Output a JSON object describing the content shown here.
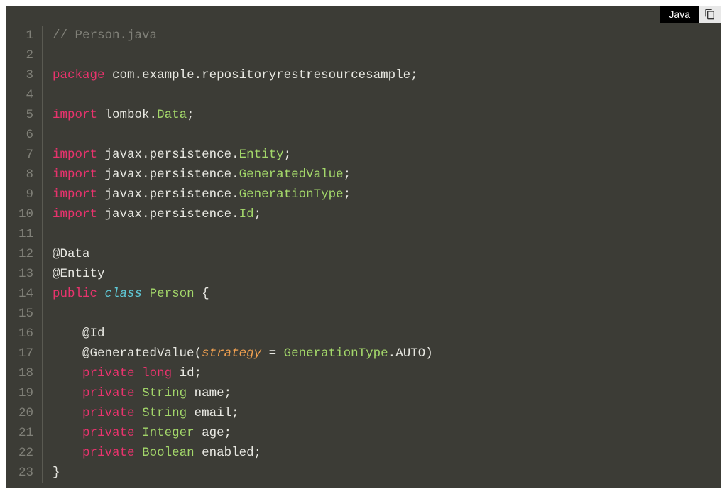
{
  "language_badge": "Java",
  "line_count": 23,
  "code": {
    "lines": [
      [
        {
          "t": "comment",
          "v": "// Person.java"
        }
      ],
      [],
      [
        {
          "t": "keyword",
          "v": "package"
        },
        {
          "t": "plain",
          "v": " com"
        },
        {
          "t": "punct",
          "v": "."
        },
        {
          "t": "plain",
          "v": "example"
        },
        {
          "t": "punct",
          "v": "."
        },
        {
          "t": "plain",
          "v": "repositoryrestresourcesample"
        },
        {
          "t": "punct",
          "v": ";"
        }
      ],
      [],
      [
        {
          "t": "keyword",
          "v": "import"
        },
        {
          "t": "plain",
          "v": " lombok"
        },
        {
          "t": "punct",
          "v": "."
        },
        {
          "t": "type",
          "v": "Data"
        },
        {
          "t": "punct",
          "v": ";"
        }
      ],
      [],
      [
        {
          "t": "keyword",
          "v": "import"
        },
        {
          "t": "plain",
          "v": " javax"
        },
        {
          "t": "punct",
          "v": "."
        },
        {
          "t": "plain",
          "v": "persistence"
        },
        {
          "t": "punct",
          "v": "."
        },
        {
          "t": "type",
          "v": "Entity"
        },
        {
          "t": "punct",
          "v": ";"
        }
      ],
      [
        {
          "t": "keyword",
          "v": "import"
        },
        {
          "t": "plain",
          "v": " javax"
        },
        {
          "t": "punct",
          "v": "."
        },
        {
          "t": "plain",
          "v": "persistence"
        },
        {
          "t": "punct",
          "v": "."
        },
        {
          "t": "type",
          "v": "GeneratedValue"
        },
        {
          "t": "punct",
          "v": ";"
        }
      ],
      [
        {
          "t": "keyword",
          "v": "import"
        },
        {
          "t": "plain",
          "v": " javax"
        },
        {
          "t": "punct",
          "v": "."
        },
        {
          "t": "plain",
          "v": "persistence"
        },
        {
          "t": "punct",
          "v": "."
        },
        {
          "t": "type",
          "v": "GenerationType"
        },
        {
          "t": "punct",
          "v": ";"
        }
      ],
      [
        {
          "t": "keyword",
          "v": "import"
        },
        {
          "t": "plain",
          "v": " javax"
        },
        {
          "t": "punct",
          "v": "."
        },
        {
          "t": "plain",
          "v": "persistence"
        },
        {
          "t": "punct",
          "v": "."
        },
        {
          "t": "type",
          "v": "Id"
        },
        {
          "t": "punct",
          "v": ";"
        }
      ],
      [],
      [
        {
          "t": "plain",
          "v": "@Data"
        }
      ],
      [
        {
          "t": "plain",
          "v": "@Entity"
        }
      ],
      [
        {
          "t": "keyword",
          "v": "public"
        },
        {
          "t": "plain",
          "v": " "
        },
        {
          "t": "class-kw",
          "v": "class"
        },
        {
          "t": "plain",
          "v": " "
        },
        {
          "t": "type",
          "v": "Person"
        },
        {
          "t": "plain",
          "v": " "
        },
        {
          "t": "punct",
          "v": "{"
        }
      ],
      [],
      [
        {
          "t": "plain",
          "v": "    @Id"
        }
      ],
      [
        {
          "t": "plain",
          "v": "    @GeneratedValue"
        },
        {
          "t": "punct",
          "v": "("
        },
        {
          "t": "param",
          "v": "strategy"
        },
        {
          "t": "plain",
          "v": " "
        },
        {
          "t": "punct",
          "v": "="
        },
        {
          "t": "plain",
          "v": " "
        },
        {
          "t": "type",
          "v": "GenerationType"
        },
        {
          "t": "punct",
          "v": "."
        },
        {
          "t": "plain",
          "v": "AUTO"
        },
        {
          "t": "punct",
          "v": ")"
        }
      ],
      [
        {
          "t": "plain",
          "v": "    "
        },
        {
          "t": "keyword",
          "v": "private"
        },
        {
          "t": "plain",
          "v": " "
        },
        {
          "t": "keyword",
          "v": "long"
        },
        {
          "t": "plain",
          "v": " id"
        },
        {
          "t": "punct",
          "v": ";"
        }
      ],
      [
        {
          "t": "plain",
          "v": "    "
        },
        {
          "t": "keyword",
          "v": "private"
        },
        {
          "t": "plain",
          "v": " "
        },
        {
          "t": "type",
          "v": "String"
        },
        {
          "t": "plain",
          "v": " name"
        },
        {
          "t": "punct",
          "v": ";"
        }
      ],
      [
        {
          "t": "plain",
          "v": "    "
        },
        {
          "t": "keyword",
          "v": "private"
        },
        {
          "t": "plain",
          "v": " "
        },
        {
          "t": "type",
          "v": "String"
        },
        {
          "t": "plain",
          "v": " email"
        },
        {
          "t": "punct",
          "v": ";"
        }
      ],
      [
        {
          "t": "plain",
          "v": "    "
        },
        {
          "t": "keyword",
          "v": "private"
        },
        {
          "t": "plain",
          "v": " "
        },
        {
          "t": "type",
          "v": "Integer"
        },
        {
          "t": "plain",
          "v": " age"
        },
        {
          "t": "punct",
          "v": ";"
        }
      ],
      [
        {
          "t": "plain",
          "v": "    "
        },
        {
          "t": "keyword",
          "v": "private"
        },
        {
          "t": "plain",
          "v": " "
        },
        {
          "t": "type",
          "v": "Boolean"
        },
        {
          "t": "plain",
          "v": " enabled"
        },
        {
          "t": "punct",
          "v": ";"
        }
      ],
      [
        {
          "t": "punct",
          "v": "}"
        }
      ]
    ]
  }
}
